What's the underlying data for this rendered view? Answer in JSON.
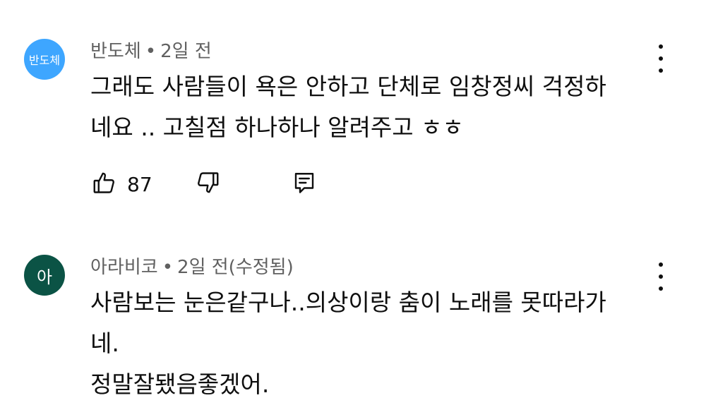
{
  "comments": [
    {
      "avatar_text": "반도체",
      "avatar_color": "#3ea6ff",
      "author": "반도체",
      "separator": "•",
      "time": "2일 전",
      "text_lines": [
        "그래도 사람들이 욕은 안하고 단체로 임창정씨 걱정하",
        "네요 .. 고칠점 하나하나 알려주고 ㅎㅎ"
      ],
      "like_count": "87",
      "icons": {
        "like": "thumbs-up-icon",
        "dislike": "thumbs-down-icon",
        "reply": "reply-icon",
        "menu": "more-vert-icon"
      }
    },
    {
      "avatar_text": "아",
      "avatar_color": "#0b5345",
      "author": "아라비코",
      "separator": "•",
      "time": "2일 전(수정됨)",
      "text_lines": [
        "사람보는 눈은같구나..의상이랑 춤이 노래를 못따라가",
        "네.",
        "정말잘됐음좋겠어."
      ],
      "icons": {
        "menu": "more-vert-icon"
      }
    }
  ]
}
